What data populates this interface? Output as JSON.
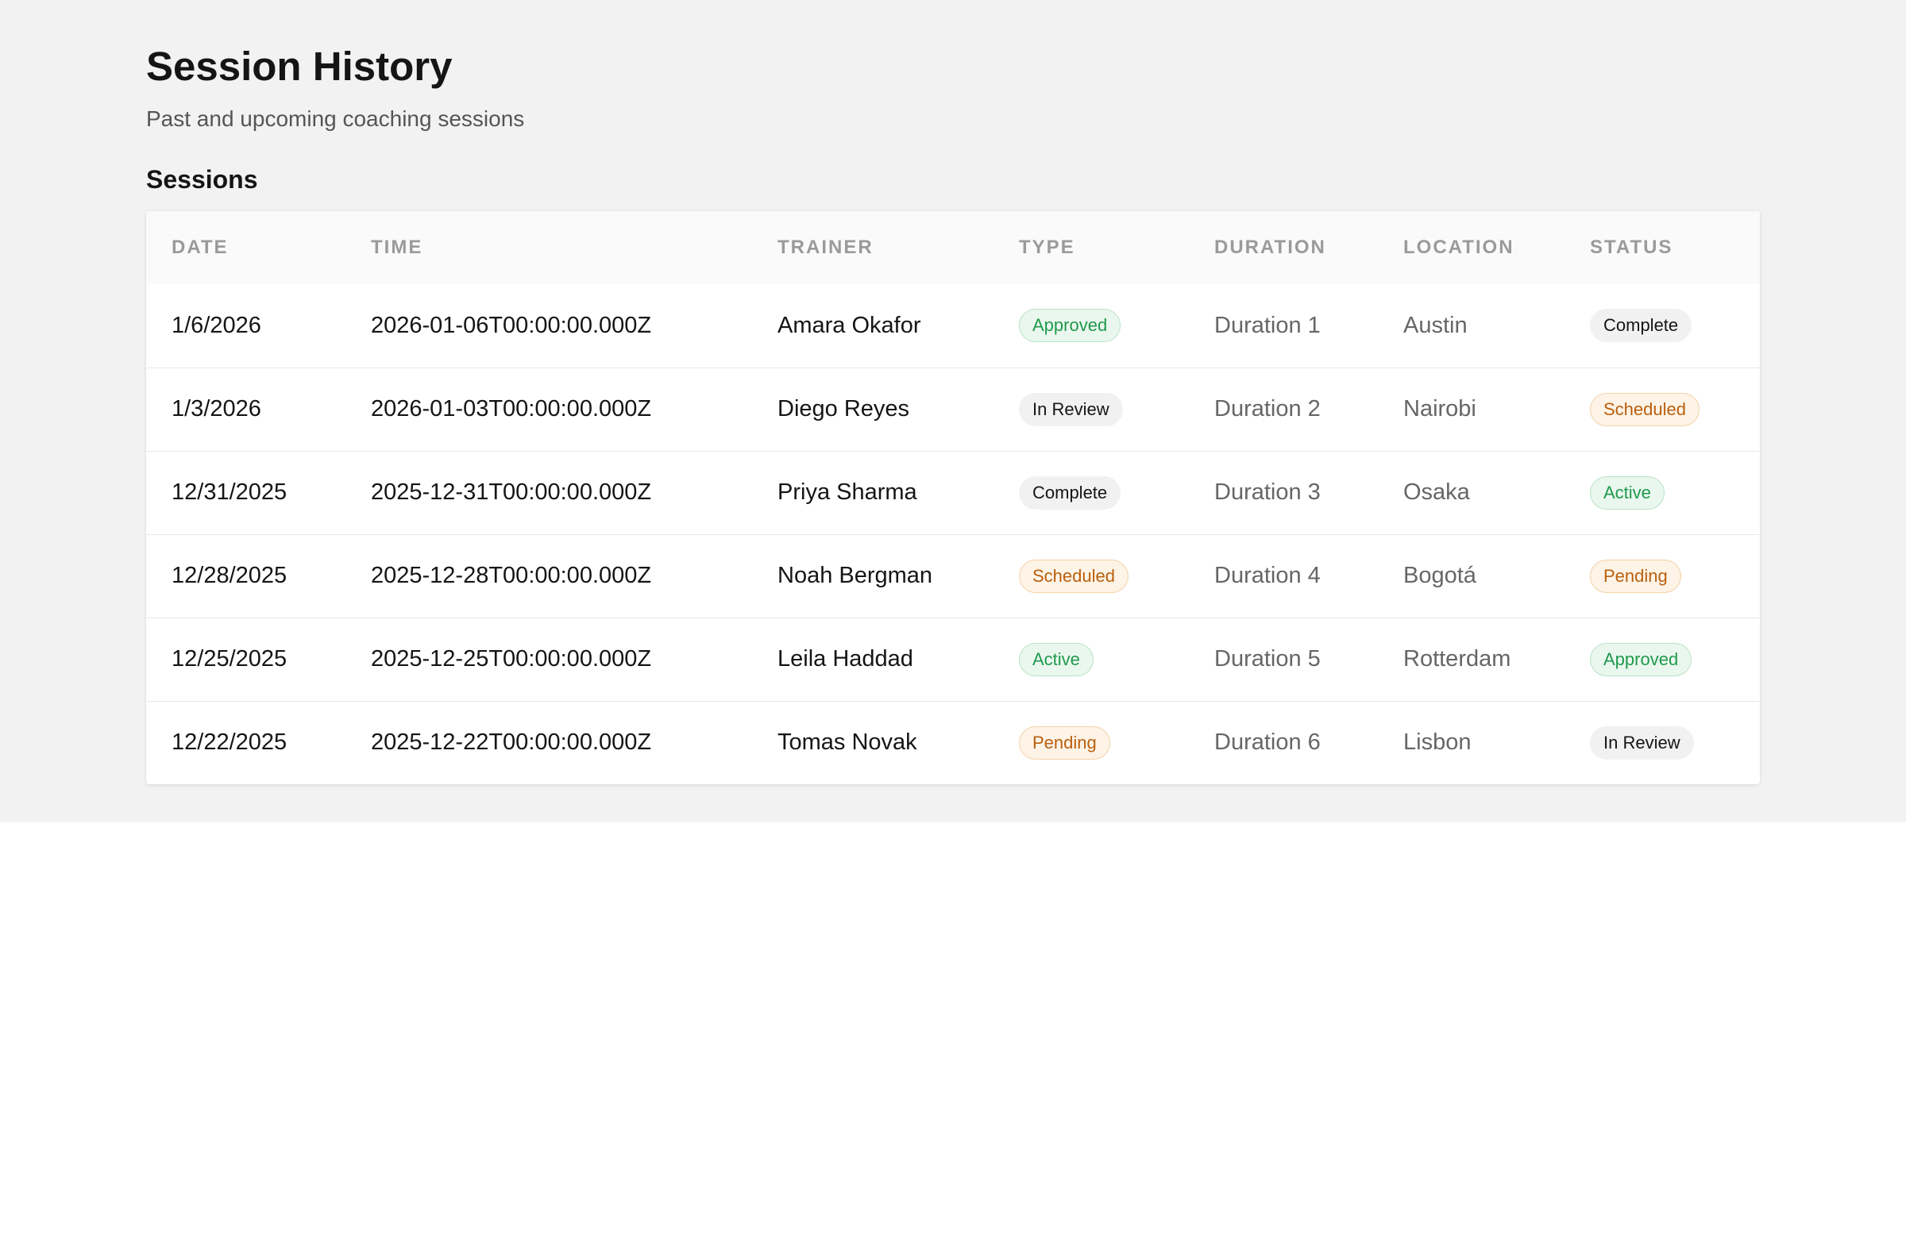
{
  "header": {
    "title": "Session History",
    "subtitle": "Past and upcoming coaching sessions"
  },
  "section": {
    "title": "Sessions"
  },
  "table": {
    "columns": [
      "DATE",
      "TIME",
      "TRAINER",
      "TYPE",
      "DURATION",
      "LOCATION",
      "STATUS"
    ],
    "rows": [
      {
        "date": "1/6/2026",
        "time": "2026-01-06T00:00:00.000Z",
        "trainer": "Amara Okafor",
        "type": "Approved",
        "type_tone": "green",
        "duration": "Duration 1",
        "location": "Austin",
        "status": "Complete",
        "status_tone": "gray"
      },
      {
        "date": "1/3/2026",
        "time": "2026-01-03T00:00:00.000Z",
        "trainer": "Diego Reyes",
        "type": "In Review",
        "type_tone": "gray",
        "duration": "Duration 2",
        "location": "Nairobi",
        "status": "Scheduled",
        "status_tone": "orange"
      },
      {
        "date": "12/31/2025",
        "time": "2025-12-31T00:00:00.000Z",
        "trainer": "Priya Sharma",
        "type": "Complete",
        "type_tone": "gray",
        "duration": "Duration 3",
        "location": "Osaka",
        "status": "Active",
        "status_tone": "green"
      },
      {
        "date": "12/28/2025",
        "time": "2025-12-28T00:00:00.000Z",
        "trainer": "Noah Bergman",
        "type": "Scheduled",
        "type_tone": "orange",
        "duration": "Duration 4",
        "location": "Bogotá",
        "status": "Pending",
        "status_tone": "orange"
      },
      {
        "date": "12/25/2025",
        "time": "2025-12-25T00:00:00.000Z",
        "trainer": "Leila Haddad",
        "type": "Active",
        "type_tone": "green",
        "duration": "Duration 5",
        "location": "Rotterdam",
        "status": "Approved",
        "status_tone": "green"
      },
      {
        "date": "12/22/2025",
        "time": "2025-12-22T00:00:00.000Z",
        "trainer": "Tomas Novak",
        "type": "Pending",
        "type_tone": "orange",
        "duration": "Duration 6",
        "location": "Lisbon",
        "status": "In Review",
        "status_tone": "gray"
      }
    ]
  },
  "colors": {
    "green": "#1f9a4c",
    "orange": "#b9600e",
    "gray": "#151515"
  }
}
